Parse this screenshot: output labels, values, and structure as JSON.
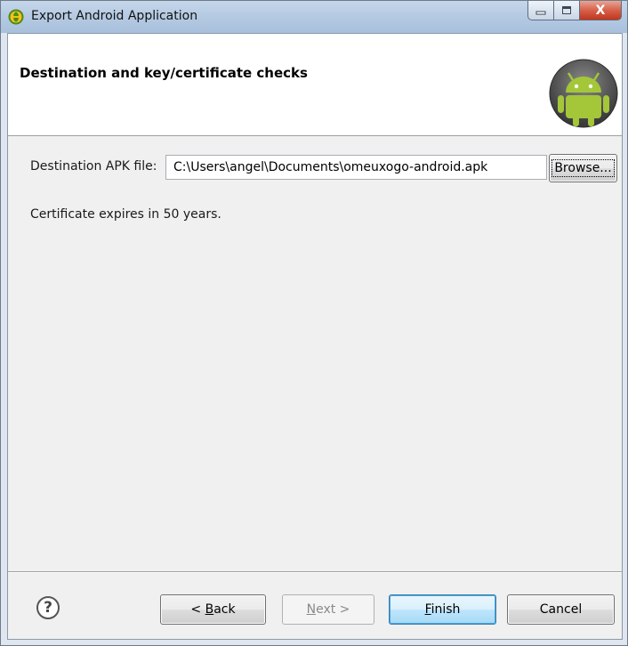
{
  "window": {
    "title": "Export Android Application",
    "minimize_glyph": "—",
    "maximize_glyph": "□",
    "close_glyph": "X"
  },
  "header": {
    "title": "Destination and key/certificate checks",
    "logo_icon": "android-logo-icon"
  },
  "destination": {
    "label": "Destination APK file:",
    "value": "C:\\Users\\angel\\Documents\\omeuxogo-android.apk",
    "browse_label": "Browse..."
  },
  "status": {
    "message": "Certificate expires in 50 years."
  },
  "footer": {
    "help_glyph": "?",
    "back_prefix": "< ",
    "back_mnemonic": "B",
    "back_rest": "ack",
    "next_mnemonic": "N",
    "next_rest": "ext >",
    "finish_mnemonic": "F",
    "finish_rest": "inish",
    "cancel_label": "Cancel"
  },
  "colors": {
    "android_green": "#a4c639",
    "close_red": "#c2361d",
    "finish_focus": "#3c7fb1"
  }
}
